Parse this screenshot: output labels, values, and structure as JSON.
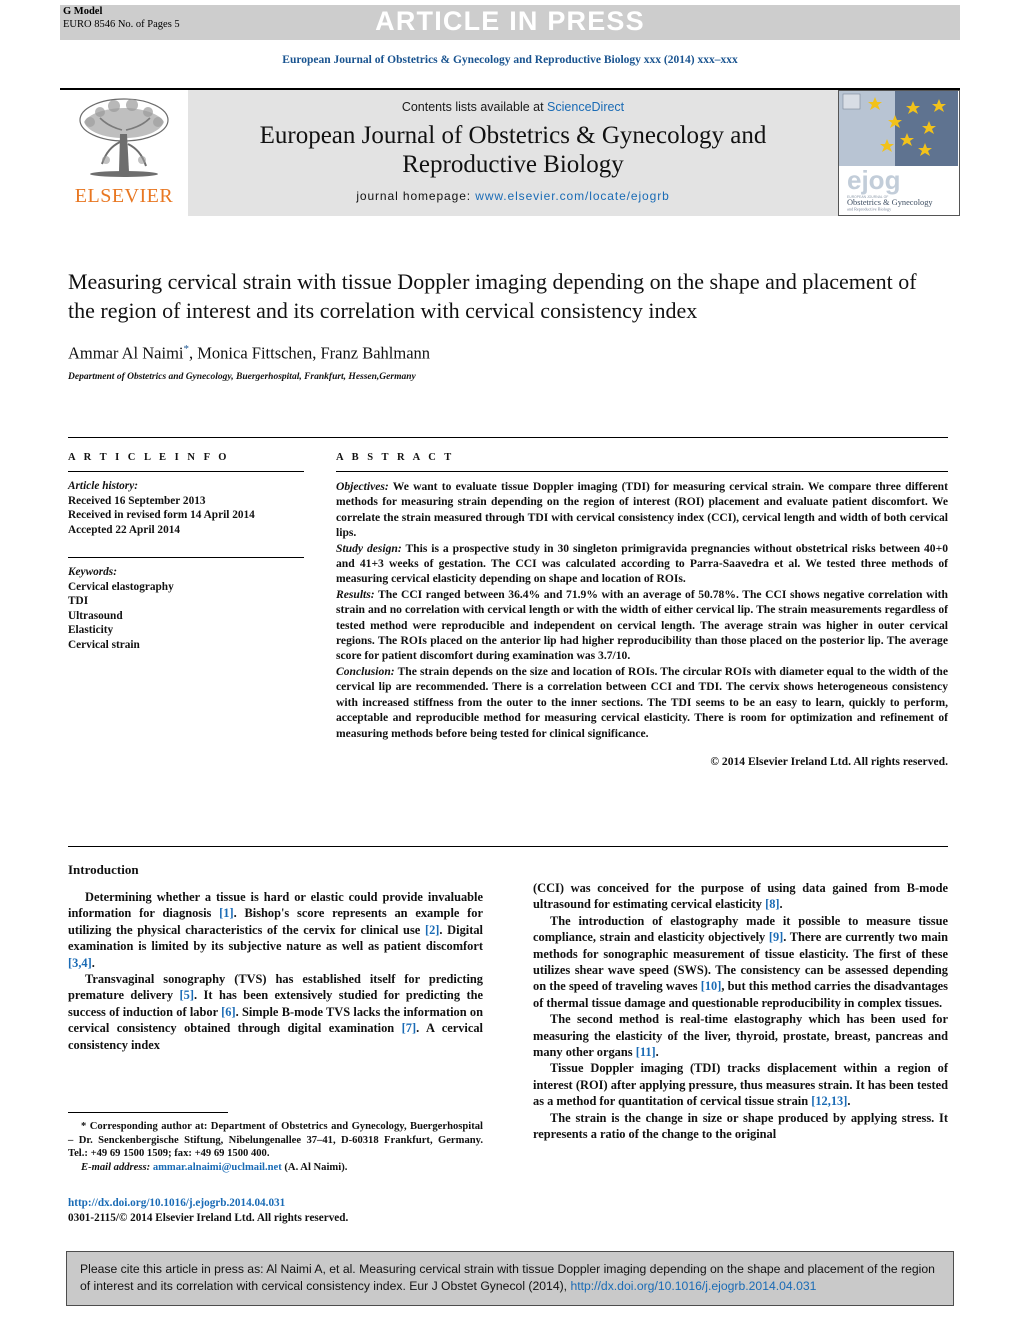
{
  "banner": {
    "press_label": "ARTICLE IN PRESS",
    "g_model": "G Model",
    "euro_line": "EURO 8546 No. of Pages 5"
  },
  "running_head": "European Journal of Obstetrics & Gynecology and Reproductive Biology xxx (2014) xxx–xxx",
  "masthead": {
    "publisher": "ELSEVIER",
    "contents_prefix": "Contents lists available at ",
    "contents_link": "ScienceDirect",
    "journal_title": "European Journal of Obstetrics & Gynecology and Reproductive Biology",
    "homepage_label": "journal homepage:",
    "homepage_url": "www.elsevier.com/locate/ejogrb",
    "cover_wordmark": "ejog",
    "cover_subtitle": "Obstetrics & Gynecology",
    "cover_subtitle2": "and Reproductive Biology"
  },
  "article": {
    "title": "Measuring cervical strain with tissue Doppler imaging depending on the shape and placement of the region of interest and its correlation with cervical consistency index",
    "authors": "Ammar Al Naimi",
    "authors_rest": ", Monica Fittschen, Franz Bahlmann",
    "author_marker": "*",
    "affiliation": "Department of Obstetrics and Gynecology, Buergerhospital, Frankfurt, Hessen,Germany"
  },
  "article_info": {
    "heading": "A R T I C L E   I N F O",
    "history_label": "Article history:",
    "history": [
      "Received 16 September 2013",
      "Received in revised form 14 April 2014",
      "Accepted 22 April 2014"
    ],
    "keywords_label": "Keywords:",
    "keywords": [
      "Cervical elastography",
      "TDI",
      "Ultrasound",
      "Elasticity",
      "Cervical strain"
    ]
  },
  "abstract": {
    "heading": "A B S T R A C T",
    "sections": [
      {
        "label": "Objectives:",
        "text": " We want to evaluate tissue Doppler imaging (TDI) for measuring cervical strain. We compare three different methods for measuring strain depending on the region of interest (ROI) placement and evaluate patient discomfort. We correlate the strain measured through TDI with cervical consistency index (CCI), cervical length and width of both cervical lips."
      },
      {
        "label": "Study design:",
        "text": " This is a prospective study in 30 singleton primigravida pregnancies without obstetrical risks between 40+0 and 41+3 weeks of gestation. The CCI was calculated according to Parra-Saavedra et al. We tested three methods of measuring cervical elasticity depending on shape and location of ROIs."
      },
      {
        "label": "Results:",
        "text": " The CCI ranged between 36.4% and 71.9% with an average of 50.78%. The CCI shows negative correlation with strain and no correlation with cervical length or with the width of either cervical lip. The strain measurements regardless of tested method were reproducible and independent on cervical length. The average strain was higher in outer cervical regions. The ROIs placed on the anterior lip had higher reproducibility than those placed on the posterior lip. The average score for patient discomfort during examination was 3.7/10."
      },
      {
        "label": "Conclusion:",
        "text": " The strain depends on the size and location of ROIs. The circular ROIs with diameter equal to the width of the cervical lip are recommended. There is a correlation between CCI and TDI. The cervix shows heterogeneous consistency with increased stiffness from the outer to the inner sections. The TDI seems to be an easy to learn, quickly to perform, acceptable and reproducible method for measuring cervical elasticity. There is room for optimization and refinement of measuring methods before being tested for clinical significance."
      }
    ],
    "copyright": "© 2014 Elsevier Ireland Ltd. All rights reserved."
  },
  "introduction": {
    "heading": "Introduction",
    "left_paragraphs": [
      {
        "pre": "Determining whether a tissue is hard or elastic could provide invaluable information for diagnosis ",
        "r1": "[1]",
        "mid1": ". Bishop's score represents an example for utilizing the physical characteristics of the cervix for clinical use ",
        "r2": "[2]",
        "mid2": ". Digital examination is limited by its subjective nature as well as patient discomfort ",
        "r3": "[3,4]",
        "post": "."
      },
      {
        "pre": "Transvaginal sonography (TVS) has established itself for predicting premature delivery ",
        "r1": "[5]",
        "mid1": ". It has been extensively studied for predicting the success of induction of labor ",
        "r2": "[6]",
        "mid2": ". Simple B-mode TVS lacks the information on cervical consistency obtained through digital examination ",
        "r3": "[7]",
        "post": ". A cervical consistency index"
      }
    ],
    "right_paragraphs": [
      {
        "pre": "(CCI) was conceived for the purpose of using data gained from B-mode ultrasound for estimating cervical elasticity ",
        "r1": "[8]",
        "post": "."
      },
      {
        "pre": "The introduction of elastography made it possible to measure tissue compliance, strain and elasticity objectively ",
        "r1": "[9]",
        "mid1": ". There are currently two main methods for sonographic measurement of tissue elasticity. The first of these utilizes shear wave speed (SWS). The consistency can be assessed depending on the speed of traveling waves ",
        "r2": "[10]",
        "post": ", but this method carries the disadvantages of thermal tissue damage and questionable reproducibility in complex tissues."
      },
      {
        "pre": "The second method is real-time elastography which has been used for measuring the elasticity of the liver, thyroid, prostate, breast, pancreas and many other organs ",
        "r1": "[11]",
        "post": "."
      },
      {
        "pre": "Tissue Doppler imaging (TDI) tracks displacement within a region of interest (ROI) after applying pressure, thus measures strain. It has been tested as a method for quantitation of cervical tissue strain ",
        "r1": "[12,13]",
        "post": "."
      },
      {
        "pre": "The strain is the change in size or shape produced by applying stress. It represents a ratio of the change to the original",
        "r1": "",
        "post": ""
      }
    ]
  },
  "footnote": {
    "marker": "*",
    "correspondence": " Corresponding author at: Department of Obstetrics and Gynecology, Buergerhospital – Dr. Senckenbergische Stiftung, Nibelungenallee 37–41, D-60318 Frankfurt, Germany. Tel.: +49 69 1500 1509; fax: +49 69 1500 400.",
    "email_label": "E-mail address:",
    "email": "ammar.alnaimi@uclmail.net",
    "email_suffix": " (A. Al Naimi)."
  },
  "doi_block": {
    "doi_url": "http://dx.doi.org/10.1016/j.ejogrb.2014.04.031",
    "issn_line": "0301-2115/© 2014 Elsevier Ireland Ltd. All rights reserved."
  },
  "cite_box": {
    "text_before": "Please cite this article in press as: Al Naimi A, et al. Measuring cervical strain with tissue Doppler imaging depending on the shape and placement of the region of interest and its correlation with cervical consistency index. Eur J Obstet Gynecol (2014), ",
    "doi": "http://dx.doi.org/10.1016/j.ejogrb.2014.04.031"
  },
  "colors": {
    "link_blue": "#1a6bb5",
    "heading_blue": "#1a5490",
    "elsevier_orange": "#E87722",
    "band_gray": "#cdcdcd",
    "masthead_gray": "#e3e3e3",
    "cite_gray": "#c9c9c9"
  }
}
